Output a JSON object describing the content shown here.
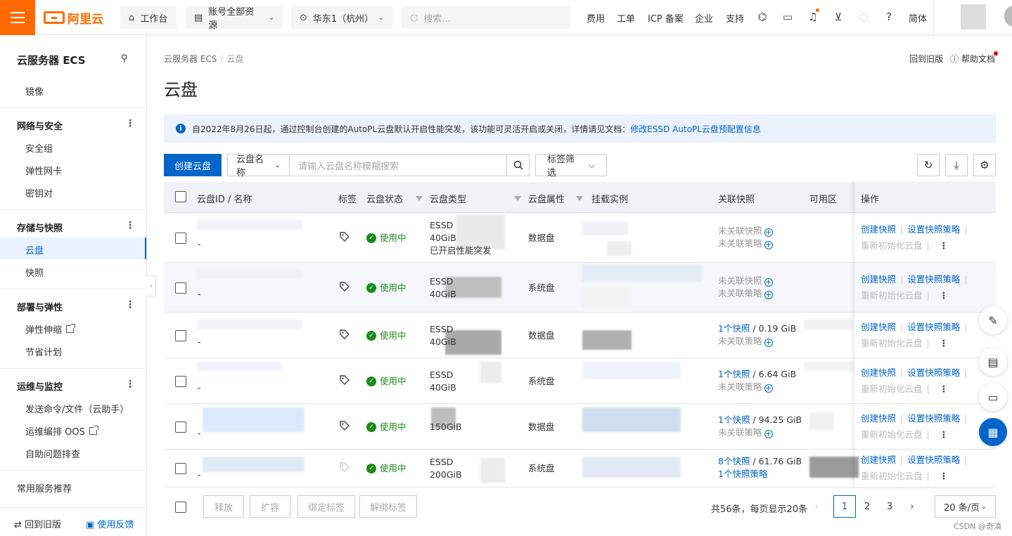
{
  "topbar": {
    "brand": "阿里云",
    "workbench": "工作台",
    "resources": "账号全部资源",
    "region": "华东1（杭州）",
    "search_placeholder": "搜索...",
    "nav": [
      "费用",
      "工单",
      "ICP 备案",
      "企业",
      "支持"
    ],
    "lang": "简体"
  },
  "sidebar": {
    "title": "云服务器 ECS",
    "image": "镜像",
    "groups": [
      {
        "title": "网络与安全",
        "items": [
          "安全组",
          "弹性网卡",
          "密钥对"
        ]
      },
      {
        "title": "存储与快照",
        "items": [
          "云盘",
          "快照"
        ]
      },
      {
        "title": "部署与弹性",
        "items": [
          "弹性伸缩",
          "节省计划"
        ]
      },
      {
        "title": "运维与监控",
        "items": [
          "发送命令/文件（云助手）",
          "运维编排 OOS",
          "自助问题排查"
        ]
      }
    ],
    "recommend": "常用服务推荐",
    "back_old": "回到旧版",
    "feedback": "使用反馈"
  },
  "main": {
    "breadcrumb": [
      "云服务器 ECS",
      "云盘"
    ],
    "title": "云盘",
    "back_old": "回到旧版",
    "help_doc": "帮助文档",
    "notice_text": "自2022年8月26日起，通过控制台创建的AutoPL云盘默认开启性能突发，该功能可灵活开启或关闭，详情请见文档：",
    "notice_link": "修改ESSD AutoPL云盘预配置信息",
    "create_button": "创建云盘",
    "filter_field": "云盘名称",
    "filter_placeholder": "请输入云盘名称模糊搜索",
    "tag_filter": "标签筛选"
  },
  "table": {
    "columns": [
      "云盘ID / 名称",
      "标签",
      "云盘状态",
      "云盘类型",
      "云盘属性",
      "挂载实例",
      "关联快照",
      "可用区",
      "操作"
    ],
    "rows": [
      {
        "name": "-",
        "status": "使用中",
        "type": "ESSD",
        "size": "40GiB",
        "extra": "已开启性能突发",
        "attr": "数据盘",
        "snap1": "未关联快照",
        "snap1_link": false,
        "snap1_size": "",
        "snap2": "未关联策略",
        "snap2_link": false
      },
      {
        "name": "-",
        "status": "使用中",
        "type": "ESSD",
        "size": "40GiB",
        "extra": "",
        "attr": "系统盘",
        "snap1": "未关联快照",
        "snap1_link": false,
        "snap1_size": "",
        "snap2": "未关联策略",
        "snap2_link": false
      },
      {
        "name": "-",
        "status": "使用中",
        "type": "ESSD",
        "size": "40GiB",
        "extra": "",
        "attr": "数据盘",
        "snap1": "1个快照",
        "snap1_link": true,
        "snap1_size": " / 0.19 GiB",
        "snap2": "未关联策略",
        "snap2_link": false
      },
      {
        "name": "-",
        "status": "使用中",
        "type": "ESSD",
        "size": "40GiB",
        "extra": "",
        "attr": "系统盘",
        "snap1": "1个快照",
        "snap1_link": true,
        "snap1_size": " / 6.64 GiB",
        "snap2": "未关联策略",
        "snap2_link": false
      },
      {
        "name": "-",
        "status": "使用中",
        "type": "",
        "size": "150GiB",
        "extra": "",
        "attr": "数据盘",
        "snap1": "1个快照",
        "snap1_link": true,
        "snap1_size": " / 94.25 GiB",
        "snap2": "未关联策略",
        "snap2_link": false
      },
      {
        "name": "-",
        "status": "使用中",
        "type": "ESSD",
        "size": "200GiB",
        "extra": "",
        "attr": "系统盘",
        "snap1": "8个快照",
        "snap1_link": true,
        "snap1_size": " / 61.76 GiB",
        "snap2": "1个快照策略",
        "snap2_link": true
      }
    ],
    "ops": {
      "create_snapshot": "创建快照",
      "set_policy": "设置快照策略",
      "reinit": "重新初始化云盘"
    }
  },
  "footer": {
    "release": "释放",
    "expand": "扩容",
    "bind_tag": "绑定标签",
    "unbind_tag": "解绑标签",
    "total": "共56条，每页显示20条",
    "pages": [
      "1",
      "2",
      "3"
    ],
    "per_page": "20 条/页"
  },
  "watermark": "CSDN @奇滇"
}
